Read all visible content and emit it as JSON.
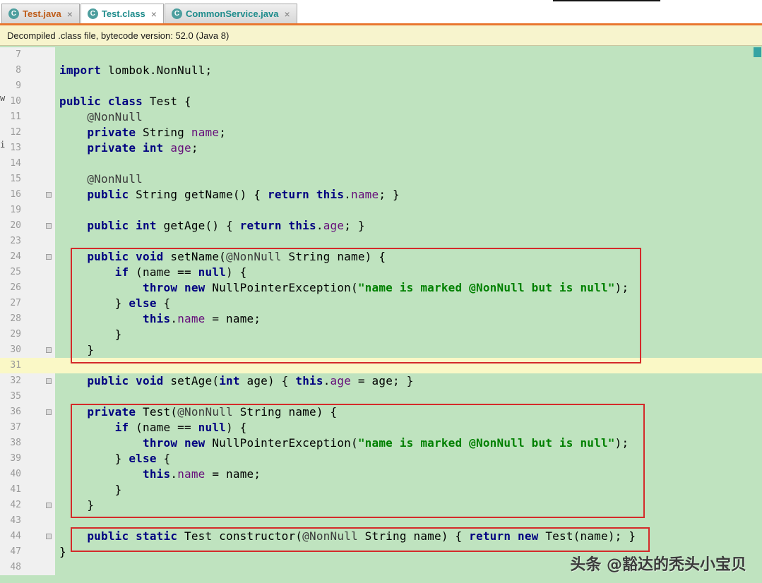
{
  "tabs": [
    {
      "label": "Test.java",
      "icon": "class-icon",
      "color": "#be5b17",
      "active": false
    },
    {
      "label": "Test.class",
      "icon": "class-icon",
      "color": "#1f8c8c",
      "active": true
    },
    {
      "label": "CommonService.java",
      "icon": "class-icon",
      "color": "#1f8c8c",
      "active": false
    }
  ],
  "banner": {
    "text": "Decompiled .class file, bytecode version: 52.0 (Java 8)"
  },
  "watermark": {
    "text": "头条 @豁达的秃头小宝贝"
  },
  "edge_fragments": [
    {
      "text": "w"
    },
    {
      "text": "i"
    }
  ],
  "colors": {
    "editor_bg": "#bfe3bf",
    "current_line": "#faf8c6",
    "banner_bg": "#f7f4cd",
    "accent_orange": "#e8762f",
    "annotation_box": "#d42a2a",
    "keyword": "#000080",
    "string": "#008000",
    "field": "#660e7a"
  },
  "editor": {
    "lines": [
      {
        "num": "7",
        "tokens": []
      },
      {
        "num": "8",
        "tokens": [
          {
            "t": "import",
            "c": "kw"
          },
          {
            "t": " lombok.NonNull;",
            "c": "pl"
          }
        ]
      },
      {
        "num": "9",
        "tokens": []
      },
      {
        "num": "10",
        "tokens": [
          {
            "t": "public class",
            "c": "kw"
          },
          {
            "t": " Test {",
            "c": "pl"
          }
        ]
      },
      {
        "num": "11",
        "tokens": [
          {
            "t": "    ",
            "c": "pl"
          },
          {
            "t": "@NonNull",
            "c": "ann"
          }
        ]
      },
      {
        "num": "12",
        "tokens": [
          {
            "t": "    ",
            "c": "pl"
          },
          {
            "t": "private",
            "c": "kw"
          },
          {
            "t": " String ",
            "c": "pl"
          },
          {
            "t": "name",
            "c": "fld"
          },
          {
            "t": ";",
            "c": "pl"
          }
        ]
      },
      {
        "num": "13",
        "tokens": [
          {
            "t": "    ",
            "c": "pl"
          },
          {
            "t": "private int",
            "c": "kw"
          },
          {
            "t": " ",
            "c": "pl"
          },
          {
            "t": "age",
            "c": "fld"
          },
          {
            "t": ";",
            "c": "pl"
          }
        ]
      },
      {
        "num": "14",
        "tokens": []
      },
      {
        "num": "15",
        "tokens": [
          {
            "t": "    ",
            "c": "pl"
          },
          {
            "t": "@NonNull",
            "c": "ann"
          }
        ]
      },
      {
        "num": "16",
        "marker": true,
        "tokens": [
          {
            "t": "    ",
            "c": "pl"
          },
          {
            "t": "public",
            "c": "kw"
          },
          {
            "t": " String getName() { ",
            "c": "pl"
          },
          {
            "t": "return this",
            "c": "kw"
          },
          {
            "t": ".",
            "c": "pl"
          },
          {
            "t": "name",
            "c": "fld"
          },
          {
            "t": "; }",
            "c": "pl"
          }
        ]
      },
      {
        "num": "19",
        "tokens": []
      },
      {
        "num": "20",
        "marker": true,
        "tokens": [
          {
            "t": "    ",
            "c": "pl"
          },
          {
            "t": "public int",
            "c": "kw"
          },
          {
            "t": " getAge() { ",
            "c": "pl"
          },
          {
            "t": "return this",
            "c": "kw"
          },
          {
            "t": ".",
            "c": "pl"
          },
          {
            "t": "age",
            "c": "fld"
          },
          {
            "t": "; }",
            "c": "pl"
          }
        ]
      },
      {
        "num": "23",
        "tokens": []
      },
      {
        "num": "24",
        "marker": true,
        "tokens": [
          {
            "t": "    ",
            "c": "pl"
          },
          {
            "t": "public void",
            "c": "kw"
          },
          {
            "t": " setName(",
            "c": "pl"
          },
          {
            "t": "@NonNull",
            "c": "ann"
          },
          {
            "t": " String name) {",
            "c": "pl"
          }
        ]
      },
      {
        "num": "25",
        "tokens": [
          {
            "t": "        ",
            "c": "pl"
          },
          {
            "t": "if",
            "c": "kw"
          },
          {
            "t": " (name == ",
            "c": "pl"
          },
          {
            "t": "null",
            "c": "kw"
          },
          {
            "t": ") {",
            "c": "pl"
          }
        ]
      },
      {
        "num": "26",
        "tokens": [
          {
            "t": "            ",
            "c": "pl"
          },
          {
            "t": "throw new",
            "c": "kw"
          },
          {
            "t": " NullPointerException(",
            "c": "pl"
          },
          {
            "t": "\"name is marked @NonNull but is null\"",
            "c": "str"
          },
          {
            "t": ");",
            "c": "pl"
          }
        ]
      },
      {
        "num": "27",
        "tokens": [
          {
            "t": "        } ",
            "c": "pl"
          },
          {
            "t": "else",
            "c": "kw"
          },
          {
            "t": " {",
            "c": "pl"
          }
        ]
      },
      {
        "num": "28",
        "tokens": [
          {
            "t": "            ",
            "c": "pl"
          },
          {
            "t": "this",
            "c": "kw"
          },
          {
            "t": ".",
            "c": "pl"
          },
          {
            "t": "name",
            "c": "fld"
          },
          {
            "t": " = name;",
            "c": "pl"
          }
        ]
      },
      {
        "num": "29",
        "tokens": [
          {
            "t": "        }",
            "c": "pl"
          }
        ]
      },
      {
        "num": "30",
        "marker": true,
        "tokens": [
          {
            "t": "    }",
            "c": "pl"
          }
        ]
      },
      {
        "num": "31",
        "current": true,
        "tokens": []
      },
      {
        "num": "32",
        "marker": true,
        "tokens": [
          {
            "t": "    ",
            "c": "pl"
          },
          {
            "t": "public void",
            "c": "kw"
          },
          {
            "t": " setAge(",
            "c": "pl"
          },
          {
            "t": "int",
            "c": "kw"
          },
          {
            "t": " age) { ",
            "c": "pl"
          },
          {
            "t": "this",
            "c": "kw"
          },
          {
            "t": ".",
            "c": "pl"
          },
          {
            "t": "age",
            "c": "fld"
          },
          {
            "t": " = age; }",
            "c": "pl"
          }
        ]
      },
      {
        "num": "35",
        "tokens": []
      },
      {
        "num": "36",
        "marker": true,
        "tokens": [
          {
            "t": "    ",
            "c": "pl"
          },
          {
            "t": "private",
            "c": "kw"
          },
          {
            "t": " Test(",
            "c": "pl"
          },
          {
            "t": "@NonNull",
            "c": "ann"
          },
          {
            "t": " String name) {",
            "c": "pl"
          }
        ]
      },
      {
        "num": "37",
        "tokens": [
          {
            "t": "        ",
            "c": "pl"
          },
          {
            "t": "if",
            "c": "kw"
          },
          {
            "t": " (name == ",
            "c": "pl"
          },
          {
            "t": "null",
            "c": "kw"
          },
          {
            "t": ") {",
            "c": "pl"
          }
        ]
      },
      {
        "num": "38",
        "tokens": [
          {
            "t": "            ",
            "c": "pl"
          },
          {
            "t": "throw new",
            "c": "kw"
          },
          {
            "t": " NullPointerException(",
            "c": "pl"
          },
          {
            "t": "\"name is marked @NonNull but is null\"",
            "c": "str"
          },
          {
            "t": ");",
            "c": "pl"
          }
        ]
      },
      {
        "num": "39",
        "tokens": [
          {
            "t": "        } ",
            "c": "pl"
          },
          {
            "t": "else",
            "c": "kw"
          },
          {
            "t": " {",
            "c": "pl"
          }
        ]
      },
      {
        "num": "40",
        "tokens": [
          {
            "t": "            ",
            "c": "pl"
          },
          {
            "t": "this",
            "c": "kw"
          },
          {
            "t": ".",
            "c": "pl"
          },
          {
            "t": "name",
            "c": "fld"
          },
          {
            "t": " = name;",
            "c": "pl"
          }
        ]
      },
      {
        "num": "41",
        "tokens": [
          {
            "t": "        }",
            "c": "pl"
          }
        ]
      },
      {
        "num": "42",
        "marker": true,
        "tokens": [
          {
            "t": "    }",
            "c": "pl"
          }
        ]
      },
      {
        "num": "43",
        "tokens": []
      },
      {
        "num": "44",
        "marker": true,
        "tokens": [
          {
            "t": "    ",
            "c": "pl"
          },
          {
            "t": "public static",
            "c": "kw"
          },
          {
            "t": " Test constructor(",
            "c": "pl"
          },
          {
            "t": "@NonNull",
            "c": "ann"
          },
          {
            "t": " String name) { ",
            "c": "pl"
          },
          {
            "t": "return new",
            "c": "kw"
          },
          {
            "t": " Test(name); }",
            "c": "pl"
          }
        ]
      },
      {
        "num": "47",
        "tokens": [
          {
            "t": "}",
            "c": "pl"
          }
        ]
      },
      {
        "num": "48",
        "tokens": []
      }
    ]
  }
}
